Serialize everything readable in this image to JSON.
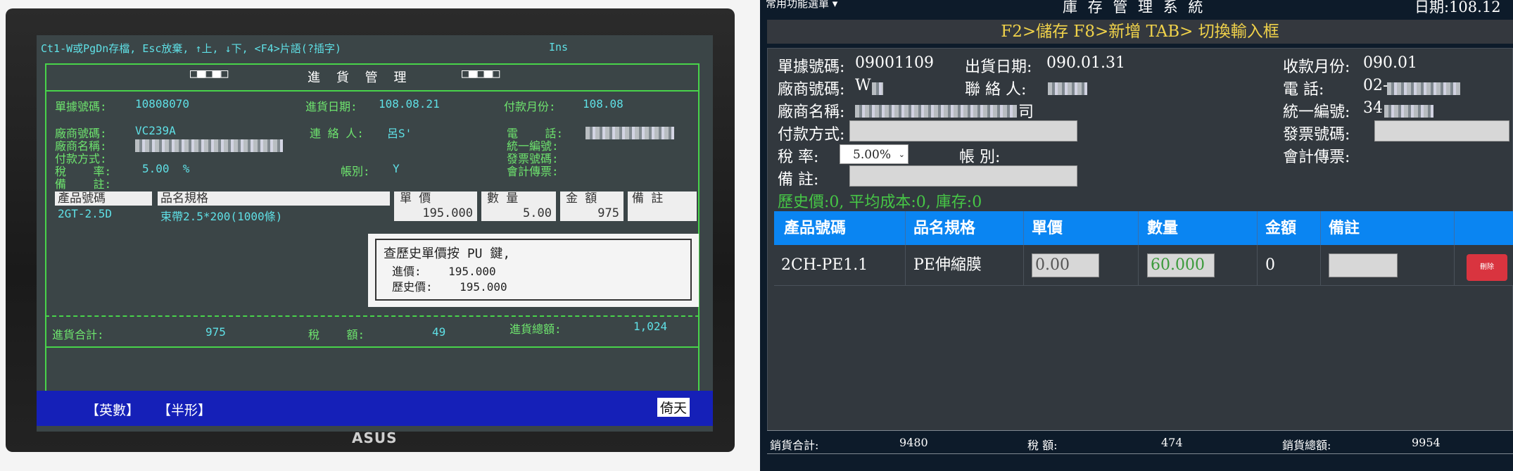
{
  "left": {
    "help_line": "Ct1-W或PgDn存檔, Esc放棄, ↑上, ↓下, <F4>片語(?插字)",
    "ins_label": "Ins",
    "title_blocks_left": "□■□■□",
    "title": "進 貨 管 理",
    "title_blocks_right": "□■□■□",
    "doc_no_label": "單據號碼:",
    "doc_no_value": "10808070",
    "date_label": "進貨日期:",
    "date_value": "108.08.21",
    "pay_month_label": "付款月份:",
    "pay_month_value": "108.08",
    "vendor_no_label": "廠商號碼:",
    "vendor_no_value": "VC239A",
    "contact_label": "連 絡 人:",
    "contact_value": "呂S'",
    "phone_label": "電    話:",
    "vendor_name_label": "廠商名稱:",
    "tax_id_label": "統一編號:",
    "pay_method_label": "付款方式:",
    "invoice_label": "發票號碼:",
    "tax_rate_label": "稅    率:",
    "tax_rate_value": "5.00  %",
    "account_label": "帳別:",
    "account_value": "Y",
    "voucher_label": "會計傳票:",
    "remark_label": "備    註:",
    "col_code": "產品號碼",
    "col_spec": "品名規格",
    "col_price": "單  價",
    "col_qty": "數  量",
    "col_amount": "金  額",
    "col_note": "備  註",
    "price_box": "195.000",
    "qty_box": "5.00",
    "amount_box": "975",
    "row_code": "2GT-2.5D",
    "row_spec": "束帶2.5*200(1000條)",
    "popup_title": "查歷史單價按 PU 鍵,",
    "popup_line1": "進價:    195.000",
    "popup_line2": "歷史價:    195.000",
    "total_label": "進貨合計:",
    "total_value": "975",
    "tax_label": "稅    額:",
    "tax_value": "49",
    "grand_label": "進貨總額:",
    "grand_value": "1,024",
    "status_en": "【英數】",
    "status_half": "【半形】",
    "status_right": "倚天",
    "brand": "ASUS"
  },
  "right": {
    "menu_label": "常用功能選單 ▾",
    "system_title": "庫 存 管 理 系 統",
    "date_label": "日期:108.12",
    "hint": "F2>儲存 F8>新增 TAB> 切換輸入框",
    "doc_no_label": "單據號碼:",
    "doc_no_value": "09001109",
    "ship_date_label": "出貨日期:",
    "ship_date_value": "090.01.31",
    "collect_month_label": "收款月份:",
    "collect_month_value": "090.01",
    "vendor_no_label": "廠商號碼:",
    "vendor_no_value": "W",
    "contact_label": "聯 絡 人:",
    "phone_label": "電    話:",
    "phone_value": "02-",
    "vendor_name_label": "廠商名稱:",
    "vendor_name_suffix": "司",
    "tax_id_label": "統一編號:",
    "tax_id_value": "34",
    "pay_method_label": "付款方式:",
    "invoice_label": "發票號碼:",
    "tax_rate_label": "稅    率:",
    "tax_rate_value": "5.00%",
    "account_label": "帳    別:",
    "voucher_label": "會計傳票:",
    "remark_label": "備    註:",
    "history_line": "歷史價:0, 平均成本:0, 庫存:0",
    "columns": [
      "產品號碼",
      "品名規格",
      "單價",
      "數量",
      "金額",
      "備註"
    ],
    "row": {
      "code": "2CH-PE1.1",
      "spec": "PE伸縮膜",
      "price": "0.00",
      "qty": "60.000",
      "amount": "0",
      "delete_label": "刪除"
    },
    "footer": {
      "sales_total_label": "銷貨合計:",
      "sales_total_value": "9480",
      "tax_label": "稅    額:",
      "tax_value": "474",
      "grand_total_label": "銷貨總額:",
      "grand_total_value": "9954"
    },
    "colors": {
      "hint": "#f0d24a",
      "header": "#0a85f2",
      "history": "#46c646",
      "delete": "#d9343f"
    }
  }
}
